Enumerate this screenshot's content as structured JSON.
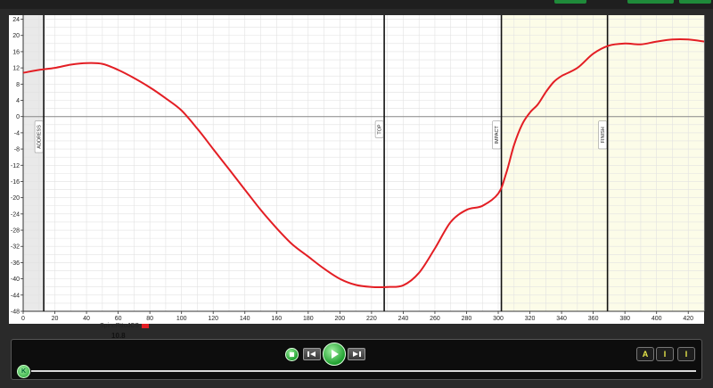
{
  "chart_data": {
    "type": "line",
    "x_range": [
      0,
      430
    ],
    "y_range": [
      -48,
      25
    ],
    "x_ticks": [
      0,
      20,
      40,
      60,
      80,
      100,
      120,
      140,
      160,
      180,
      200,
      220,
      240,
      260,
      280,
      300,
      320,
      340,
      360,
      380,
      400,
      420
    ],
    "y_ticks": [
      24,
      20,
      16,
      12,
      8,
      4,
      0,
      -4,
      -8,
      -12,
      -16,
      -20,
      -24,
      -28,
      -32,
      -36,
      -40,
      -44,
      -48
    ],
    "grid": true,
    "series": [
      {
        "name": "SpineRttoJCS",
        "color": "#e31e24",
        "x": [
          0,
          10,
          20,
          30,
          40,
          50,
          60,
          70,
          80,
          90,
          100,
          110,
          120,
          130,
          140,
          150,
          160,
          170,
          180,
          190,
          200,
          210,
          220,
          230,
          240,
          250,
          260,
          270,
          280,
          290,
          300,
          305,
          310,
          315,
          320,
          325,
          330,
          335,
          340,
          350,
          360,
          370,
          380,
          390,
          400,
          410,
          420,
          430
        ],
        "y": [
          10.8,
          11.5,
          12.0,
          12.8,
          13.2,
          13.0,
          11.5,
          9.5,
          7.2,
          4.5,
          1.5,
          -3.0,
          -8.0,
          -13.0,
          -18.0,
          -23.0,
          -27.5,
          -31.5,
          -34.5,
          -37.5,
          -40.0,
          -41.5,
          -42.0,
          -42.0,
          -41.6,
          -38.5,
          -32.5,
          -26.0,
          -23.0,
          -22.0,
          -19.0,
          -14.0,
          -7.0,
          -2.0,
          1.0,
          3.0,
          6.0,
          8.5,
          10.0,
          12.0,
          15.5,
          17.5,
          18.0,
          17.8,
          18.5,
          19.0,
          19.0,
          18.5
        ]
      }
    ],
    "events": [
      {
        "label": "ADDRESS",
        "x": 13
      },
      {
        "label": "TOP",
        "x": 228
      },
      {
        "label": "IMPACT",
        "x": 302
      },
      {
        "label": "FINISH",
        "x": 369
      }
    ],
    "highlight_range": [
      302,
      430
    ],
    "highlight_color": "#fcfce8",
    "left_shade_range": [
      0,
      13
    ]
  },
  "legend": {
    "series_label": "SpineRttoJCS",
    "current_value": "10.8",
    "swatch_color": "#e31e24"
  },
  "controls": {
    "stop_icon": "stop-icon",
    "prev_icon": "skip-back-icon",
    "play_icon": "play-icon",
    "next_icon": "skip-forward-icon",
    "right_buttons": [
      "A",
      "I",
      "I"
    ],
    "slider_knob": "K",
    "slider_position": 0.0
  }
}
